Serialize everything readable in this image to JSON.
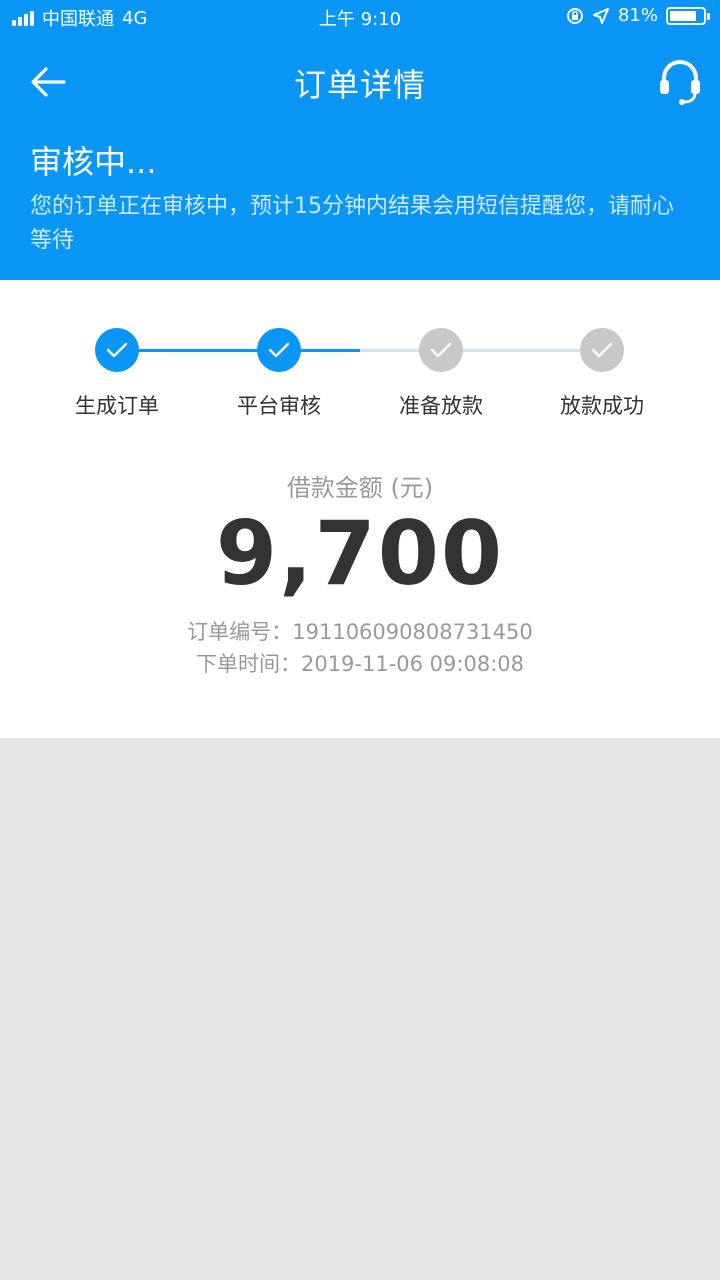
{
  "status_bar": {
    "carrier": "中国联通",
    "network": "4G",
    "time": "上午 9:10",
    "battery": "81%",
    "battery_level": 0.81
  },
  "navbar": {
    "title": "订单详情",
    "back_icon": "arrow-left-icon",
    "support_icon": "headset-icon"
  },
  "review": {
    "title": "审核中...",
    "description": "您的订单正在审核中，预计15分钟内结果会用短信提醒您，请耐心等待"
  },
  "steps": [
    {
      "label": "生成订单",
      "done": true
    },
    {
      "label": "平台审核",
      "done": true
    },
    {
      "label": "准备放款",
      "done": false
    },
    {
      "label": "放款成功",
      "done": false
    }
  ],
  "loan": {
    "amount_label": "借款金额 (元)",
    "amount": "9,700"
  },
  "order": {
    "number_label": "订单编号：",
    "number": "191106090808731450",
    "time_label": "下单时间：",
    "time": "2019-11-06 09:08:08"
  },
  "colors": {
    "primary": "#0a96f5",
    "inactive": "#c8c8c8",
    "inactive_line": "#d3e4f0",
    "background": "#e6e6e6"
  }
}
